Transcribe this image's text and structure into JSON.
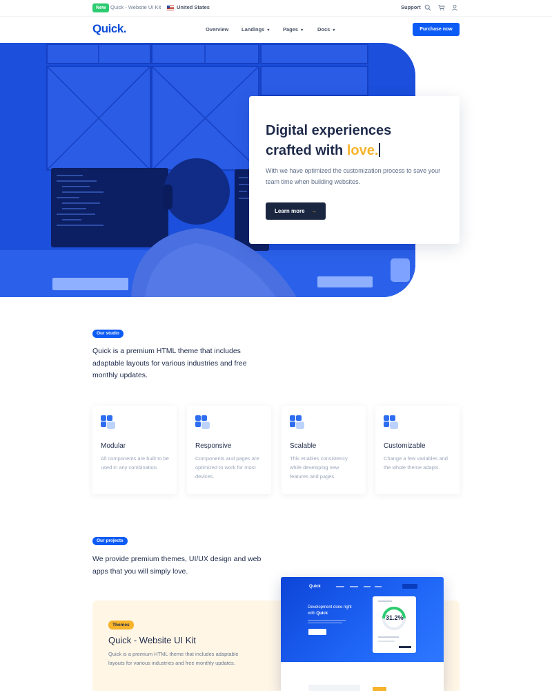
{
  "topbar": {
    "badge": "New",
    "kit_name": "Quick - Website UI Kit",
    "country": "United States",
    "support": "Support",
    "icons": [
      "search-icon",
      "cart-icon",
      "user-icon"
    ]
  },
  "nav": {
    "logo": "Quick.",
    "items": [
      {
        "label": "Overview",
        "has_dropdown": false
      },
      {
        "label": "Landings",
        "has_dropdown": true
      },
      {
        "label": "Pages",
        "has_dropdown": true
      },
      {
        "label": "Docs",
        "has_dropdown": true
      }
    ],
    "purchase_label": "Purchase now"
  },
  "hero": {
    "title_line1": "Digital experiences",
    "title_line2_prefix": "crafted with ",
    "title_highlight": "love.",
    "description": "With we have optimized the customization process to save your team time when building websites.",
    "cta_label": "Learn more"
  },
  "studio": {
    "tag": "Our studio",
    "text": "Quick is a premium HTML theme that includes adaptable layouts for various industries and free monthly updates."
  },
  "features": [
    {
      "title": "Modular",
      "description": "All components are built to be used in any combination."
    },
    {
      "title": "Responsive",
      "description": "Components and pages are optimized to work for most devices."
    },
    {
      "title": "Scalable",
      "description": "This enables consistency while developing new features and pages."
    },
    {
      "title": "Customizable",
      "description": "Change a few variables and the whole theme adapts."
    }
  ],
  "projects": {
    "tag": "Our projects",
    "text": "We provide premium themes, UI/UX design and web apps that you will simply love.",
    "item": {
      "tag": "Themes",
      "title": "Quick - Website UI Kit",
      "description": "Quick is a premium HTML theme that includes adaptable layouts for various industries and free monthly updates."
    },
    "preview": {
      "title_line1": "Development done right",
      "title_line2_prefix": "with ",
      "title_brand": "Quick",
      "stat": "31.2%"
    }
  },
  "colors": {
    "primary": "#0d5bf5",
    "accent": "#f7b32b",
    "dark": "#1b2741",
    "success": "#2ecc71"
  }
}
